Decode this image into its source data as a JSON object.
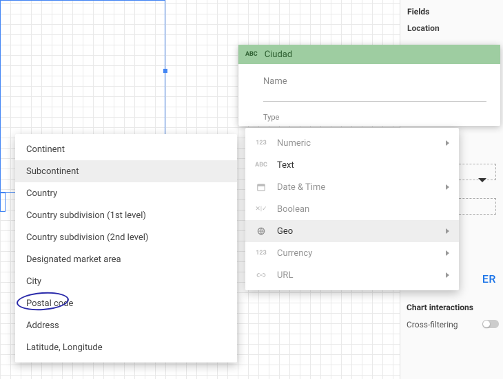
{
  "sidebar": {
    "fields_label": "Fields",
    "location_label": "Location",
    "link_label": "ER",
    "chart_interactions_label": "Chart interactions",
    "cross_filter_label": "Cross-filtering"
  },
  "field_popup": {
    "icon_label": "ABC",
    "title": "Ciudad",
    "name_label": "Name",
    "type_label": "Type"
  },
  "type_menu": {
    "items": [
      {
        "icon": "123",
        "label": "Numeric",
        "has_sub": true,
        "active": false,
        "dark": false
      },
      {
        "icon": "ABC",
        "label": "Text",
        "has_sub": false,
        "active": false,
        "dark": true
      },
      {
        "icon": "calendar",
        "label": "Date & Time",
        "has_sub": true,
        "active": false,
        "dark": false
      },
      {
        "icon": "bool",
        "label": "Boolean",
        "has_sub": false,
        "active": false,
        "dark": false
      },
      {
        "icon": "globe",
        "label": "Geo",
        "has_sub": true,
        "active": true,
        "dark": true
      },
      {
        "icon": "123",
        "label": "Currency",
        "has_sub": true,
        "active": false,
        "dark": false
      },
      {
        "icon": "link",
        "label": "URL",
        "has_sub": true,
        "active": false,
        "dark": false
      }
    ]
  },
  "geo_menu": {
    "items": [
      {
        "label": "Continent",
        "hover": false
      },
      {
        "label": "Subcontinent",
        "hover": true
      },
      {
        "label": "Country",
        "hover": false
      },
      {
        "label": "Country subdivision (1st level)",
        "hover": false
      },
      {
        "label": "Country subdivision (2nd level)",
        "hover": false
      },
      {
        "label": "Designated market area",
        "hover": false
      },
      {
        "label": "City",
        "hover": false
      },
      {
        "label": "Postal code",
        "hover": false
      },
      {
        "label": "Address",
        "hover": false
      },
      {
        "label": "Latitude, Longitude",
        "hover": false
      }
    ]
  },
  "icons": {
    "123": "123",
    "ABC": "ABC",
    "bool": "✕|✓"
  }
}
